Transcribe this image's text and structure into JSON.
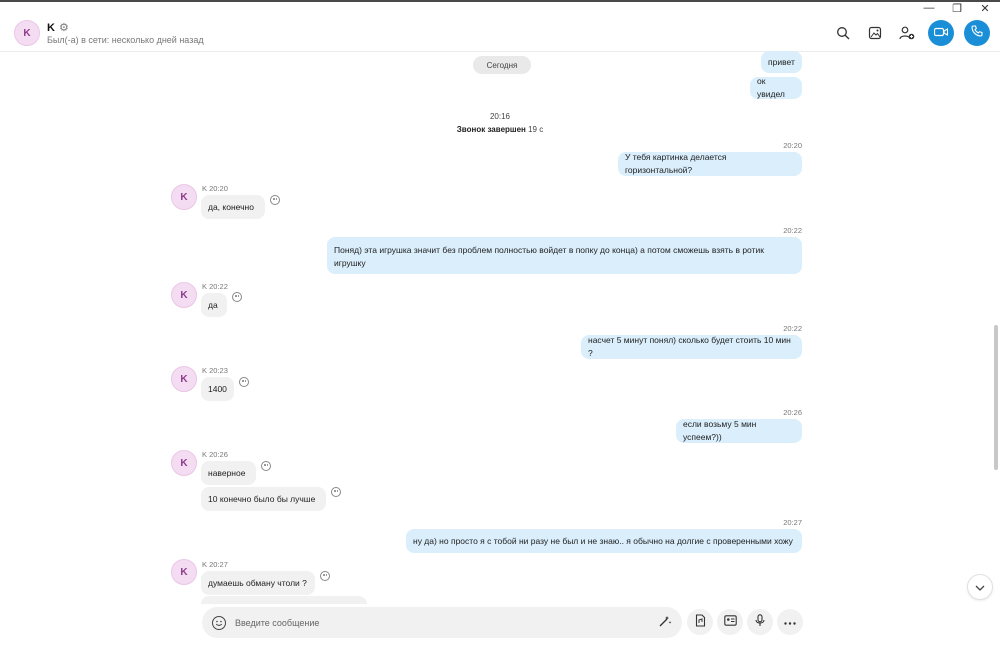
{
  "window": {
    "min": "—",
    "restore": "❐",
    "close": "✕"
  },
  "header": {
    "avatar_initial": "K",
    "contact_name": "K",
    "status": "Был(-а) в сети: несколько дней назад"
  },
  "chat": {
    "day_separator": "Сегодня",
    "call": {
      "time": "20:16",
      "label": "Звонок завершен",
      "duration": "19 с"
    },
    "outgoing": [
      {
        "text": "привет",
        "time": ""
      },
      {
        "text": "ок увидел",
        "time": ""
      },
      {
        "text": "У тебя картинка делается горизонтальной?",
        "time": "20:20"
      },
      {
        "text": "Поняд) эта игрушка значит без проблем полностью войдет в попку до конца) а потом сможешь взять в ротик игрушку",
        "time": "20:22"
      },
      {
        "text": "насчет 5 минут понял) сколько будет стоить 10 мин ?",
        "time": "20:22"
      },
      {
        "text": "если возьму 5 мин успеем?))",
        "time": "20:26"
      },
      {
        "text": "ну да) но просто я с тобой ни разу не был и не знаю.. я обычно на долгие с проверенными хожу",
        "time": "20:27"
      }
    ],
    "incoming": [
      {
        "sender": "K",
        "time": "20:20",
        "messages": [
          "да, конечно"
        ]
      },
      {
        "sender": "K",
        "time": "20:22",
        "messages": [
          "да"
        ]
      },
      {
        "sender": "K",
        "time": "20:23",
        "messages": [
          "1400"
        ]
      },
      {
        "sender": "K",
        "time": "20:26",
        "messages": [
          "наверное",
          "10 конечно было бы лучше"
        ]
      },
      {
        "sender": "K",
        "time": "20:27",
        "messages": [
          "думаешь обману чтоли ?"
        ]
      }
    ]
  },
  "composer": {
    "placeholder": "Введите сообщение"
  },
  "icons": {
    "search": "search-icon",
    "gallery": "gallery-icon",
    "add_person": "add-person-icon",
    "video": "video-call-icon",
    "phone": "audio-call-icon",
    "emoji": "emoji-icon",
    "sparkle": "magic-pen-icon",
    "file": "file-icon",
    "contact_card": "contact-card-icon",
    "mic": "microphone-icon",
    "more": "more-icon",
    "scroll_down": "chevron-down-icon"
  },
  "colors": {
    "accent": "#1a8fd8",
    "outgoing_bubble": "#daeefc",
    "incoming_bubble": "#f1f1f1",
    "avatar_bg": "#f4dcf2"
  }
}
